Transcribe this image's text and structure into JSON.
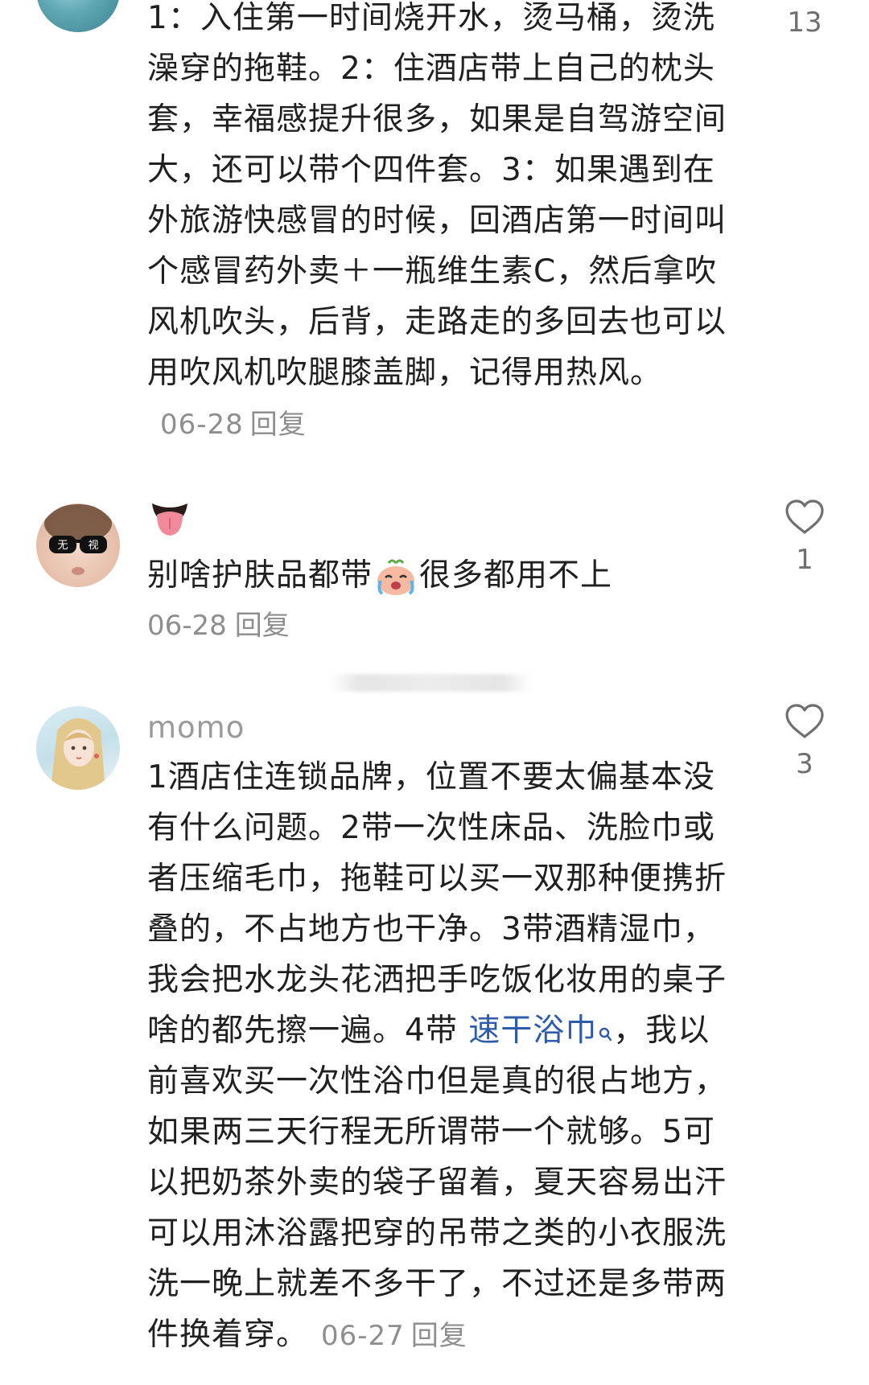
{
  "comments": [
    {
      "text": "1：入住第一时间烧开水，烫马桶，烫洗澡穿的拖鞋。2：住酒店带上自己的枕头套，幸福感提升很多，如果是自驾游空间大，还可以带个四件套。3：如果遇到在外旅游快感冒的时候，回酒店第一时间叫个感冒药外卖＋一瓶维生素C，然后拿吹风机吹头，后背，走路走的多回去也可以用吹风机吹腿膝盖脚，记得用热风。",
      "date": "06-28",
      "reply": "回复",
      "likes": "13"
    },
    {
      "text_before_emoji": "别啥护肤品都带",
      "text_after_emoji": "很多都用不上",
      "date": "06-28",
      "reply": "回复",
      "likes": "1",
      "avatar_glasses_text_1": "无",
      "avatar_glasses_text_2": "视"
    },
    {
      "author": "momo",
      "text_before_link": "1酒店住连锁品牌，位置不要太偏基本没有什么问题。2带一次性床品、洗脸巾或者压缩毛巾，拖鞋可以买一双那种便携折叠的，不占地方也干净。3带酒精湿巾，我会把水龙头花洒把手吃饭化妆用的桌子啥的都先擦一遍。4带 ",
      "link": "速干浴巾",
      "text_after_link": "，我以前喜欢买一次性浴巾但是真的很占地方，如果两三天行程无所谓带一个就够。5可以把奶茶外卖的袋子留着，夏天容易出汗可以用沐浴露把穿的吊带之类的小衣服洗洗一晚上就差不多干了，不过还是多带两件换着穿。",
      "date": "06-27",
      "reply": "回复",
      "likes": "3"
    }
  ],
  "colors": {
    "text": "#202020",
    "meta": "#8e8e8e",
    "link": "#2e5cab",
    "heart": "#6f6f6f"
  },
  "icons": {
    "heart": "heart-outline-icon",
    "search": "search-icon",
    "tongue_emoji": "tongue-emoji",
    "crying_emoji": "crying-emoji"
  }
}
